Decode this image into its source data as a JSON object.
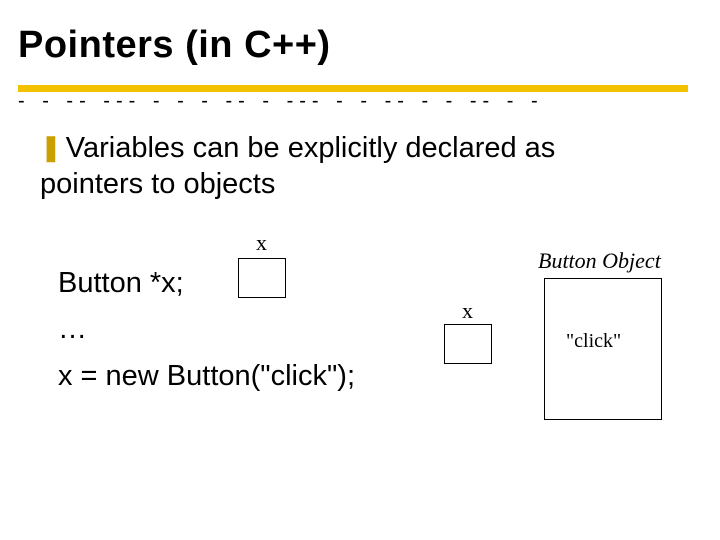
{
  "title": "Pointers (in C++)",
  "bullet_text": "Variables can be explicitly declared as pointers to objects",
  "code": {
    "line1": "Button *x;",
    "line2": "…",
    "line3": "x = new Button(\"click\");"
  },
  "diagram": {
    "x1_label": "x",
    "x2_label": "x",
    "object_label": "Button Object",
    "object_content": "\"click\""
  }
}
